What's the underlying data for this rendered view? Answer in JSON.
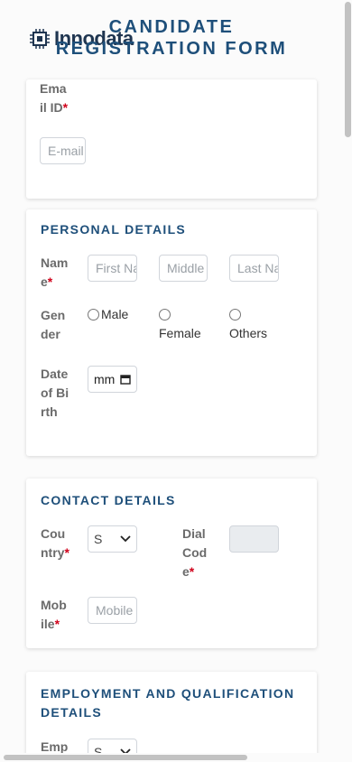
{
  "brand": {
    "logo_text": "Innodata"
  },
  "header": {
    "title": "CANDIDATE REGISTRATION FORM"
  },
  "email_section": {
    "email_label": "Email ID",
    "email_placeholder": "E-mail"
  },
  "personal": {
    "title": "PERSONAL DETAILS",
    "name_label": "Name",
    "first_placeholder": "First Name",
    "middle_placeholder": "Middle Name",
    "last_placeholder": "Last Name",
    "gender_label": "Gender",
    "gender_options": [
      "Male",
      "Female",
      "Others"
    ],
    "dob_label": "Date of Birth",
    "dob_value": "mm"
  },
  "contact": {
    "title": "CONTACT DETAILS",
    "country_label": "Country",
    "country_value": "S",
    "dial_label": "Dial Code",
    "mobile_label": "Mobile",
    "mobile_placeholder": "Mobile"
  },
  "employment": {
    "title": "EMPLOYMENT AND QUALIFICATION DETAILS",
    "emp_label": "Emp",
    "emp_value": "S"
  },
  "required_mark": "*",
  "icons": {
    "chevron": "chevron-down-icon",
    "calendar": "calendar-icon",
    "logo": "chip-logo-icon"
  }
}
